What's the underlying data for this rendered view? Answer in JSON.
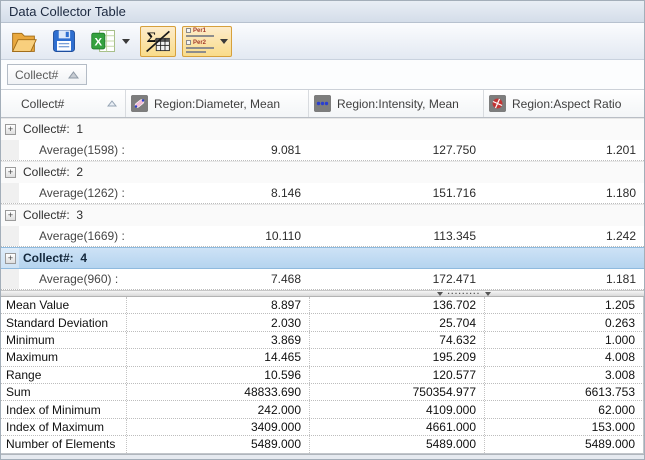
{
  "window": {
    "title": "Data Collector Table"
  },
  "toolbar": {
    "icons": [
      "open-folder",
      "save-disk",
      "export-excel",
      "statistics-sigma-toggle",
      "per-collect-toggle"
    ],
    "per_toggle_rows": [
      "Per1",
      "Per2"
    ],
    "toggle_highlight_color": "#f9dc8a",
    "toggle_border_color": "#d6a03c"
  },
  "group_by": {
    "field": "Collect#"
  },
  "table": {
    "columns": [
      "Collect#",
      "Region:Diameter, Mean",
      "Region:Intensity, Mean",
      "Region:Aspect Ratio"
    ],
    "column_icons": [
      "sort-ascending",
      "diameter-icon",
      "intensity-icon",
      "aspect-ratio-icon"
    ],
    "groups": [
      {
        "label": "Collect#:  1",
        "avg_label": "Average(1598) :",
        "values": [
          "9.081",
          "127.750",
          "1.201"
        ],
        "selected": false
      },
      {
        "label": "Collect#:  2",
        "avg_label": "Average(1262) :",
        "values": [
          "8.146",
          "151.716",
          "1.180"
        ],
        "selected": false
      },
      {
        "label": "Collect#:  3",
        "avg_label": "Average(1669) :",
        "values": [
          "10.110",
          "113.345",
          "1.242"
        ],
        "selected": false
      },
      {
        "label": "Collect#:  4",
        "avg_label": "Average(960) :",
        "values": [
          "7.468",
          "172.471",
          "1.181"
        ],
        "selected": true
      }
    ],
    "stats": [
      {
        "label": "Mean Value",
        "values": [
          "8.897",
          "136.702",
          "1.205"
        ]
      },
      {
        "label": "Standard Deviation",
        "values": [
          "2.030",
          "25.704",
          "0.263"
        ]
      },
      {
        "label": "Minimum",
        "values": [
          "3.869",
          "74.632",
          "1.000"
        ]
      },
      {
        "label": "Maximum",
        "values": [
          "14.465",
          "195.209",
          "4.008"
        ]
      },
      {
        "label": "Range",
        "values": [
          "10.596",
          "120.577",
          "3.008"
        ]
      },
      {
        "label": "Sum",
        "values": [
          "48833.690",
          "750354.977",
          "6613.753"
        ]
      },
      {
        "label": "Index of Minimum",
        "values": [
          "242.000",
          "4109.000",
          "62.000"
        ]
      },
      {
        "label": "Index of Maximum",
        "values": [
          "3409.000",
          "4661.000",
          "153.000"
        ]
      },
      {
        "label": "Number of Elements",
        "values": [
          "5489.000",
          "5489.000",
          "5489.000"
        ]
      }
    ],
    "selection_color": "#b5d4ef"
  }
}
